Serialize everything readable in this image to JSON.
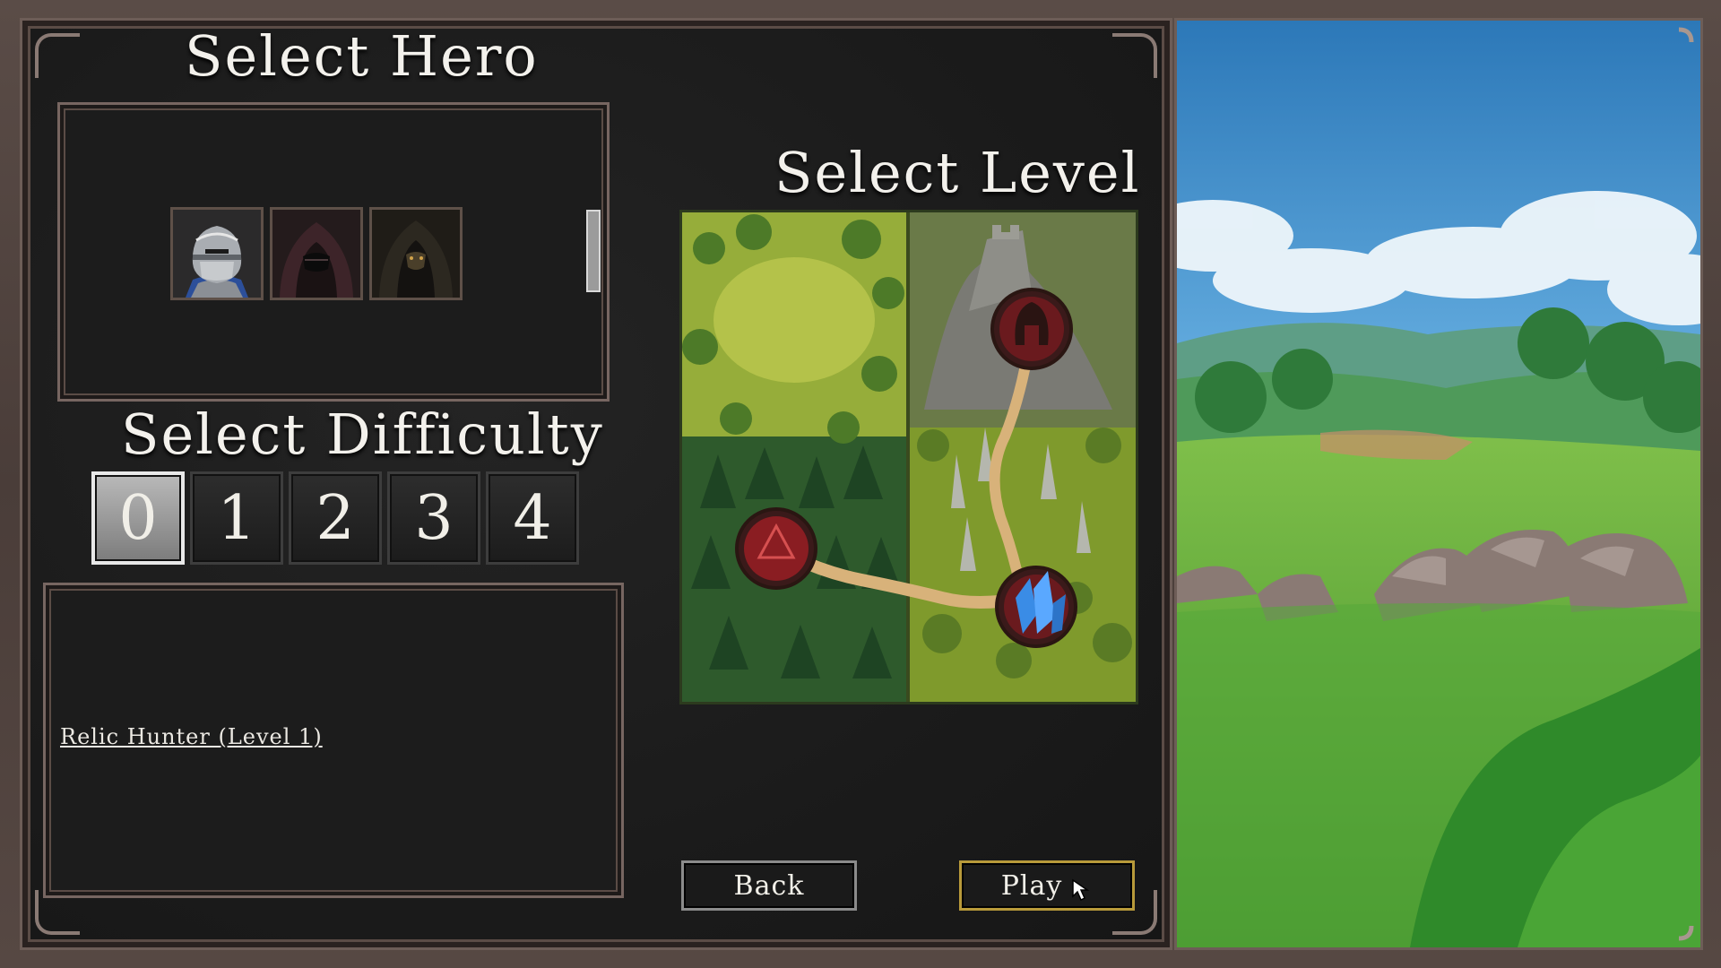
{
  "headings": {
    "select_hero": "Select Hero",
    "select_level": "Select Level",
    "select_difficulty": "Select Difficulty"
  },
  "heroes": [
    {
      "name": "knight",
      "icon": "knight-helmet-icon"
    },
    {
      "name": "hooded-rogue",
      "icon": "hooded-figure-icon"
    },
    {
      "name": "dark-hooded",
      "icon": "dark-hooded-figure-icon"
    }
  ],
  "difficulty": {
    "options": [
      "0",
      "1",
      "2",
      "3",
      "4"
    ],
    "selected": "0"
  },
  "description": {
    "hero_link": "Relic Hunter (Level 1)"
  },
  "level_map": {
    "nodes": [
      {
        "name": "forest-node",
        "icon": "red-rune-stone-icon"
      },
      {
        "name": "crystal-node",
        "icon": "blue-crystal-icon"
      },
      {
        "name": "castle-node",
        "icon": "dark-helmet-icon"
      }
    ]
  },
  "buttons": {
    "back": "Back",
    "play": "Play"
  },
  "colors": {
    "frame": "#4a3d39",
    "panel": "#1c1c1c",
    "selected_difficulty": "#b0b0b0",
    "play_border": "#b89a3a"
  }
}
